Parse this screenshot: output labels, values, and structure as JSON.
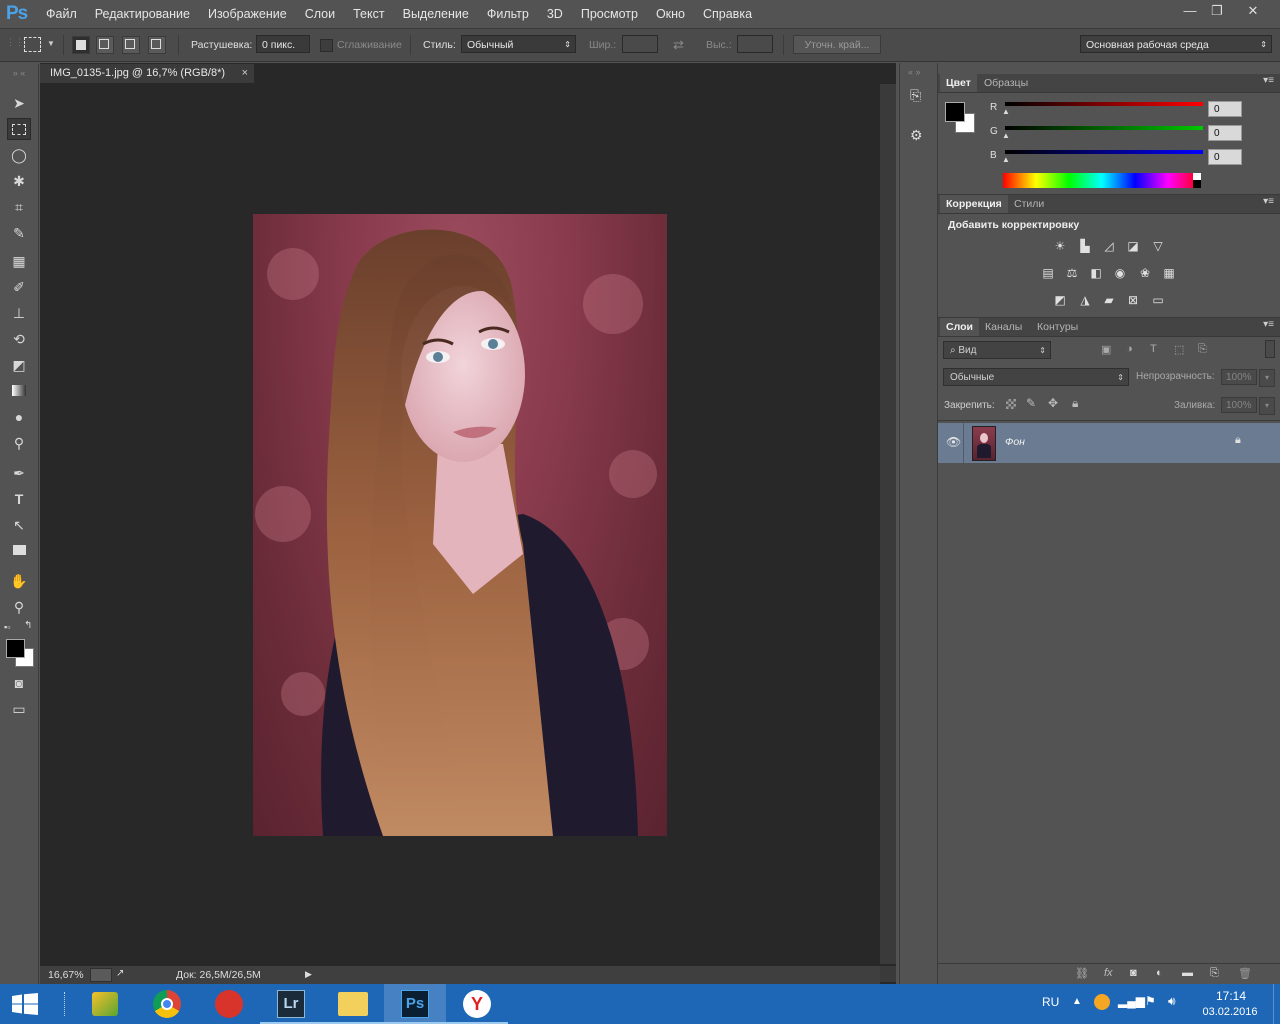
{
  "menu": {
    "items": [
      "Файл",
      "Редактирование",
      "Изображение",
      "Слои",
      "Текст",
      "Выделение",
      "Фильтр",
      "3D",
      "Просмотр",
      "Окно",
      "Справка"
    ]
  },
  "options": {
    "feather_label": "Растушевка:",
    "feather_value": "0 пикс.",
    "antialias_label": "Сглаживание",
    "style_label": "Стиль:",
    "style_value": "Обычный",
    "width_label": "Шир.:",
    "height_label": "Выс.:",
    "refine_label": "Уточн. край...",
    "workspace_value": "Основная рабочая среда"
  },
  "document": {
    "tab_title": "IMG_0135-1.jpg @ 16,7% (RGB/8*)",
    "zoom": "16,67%",
    "doc_size": "Док: 26,5M/26,5M"
  },
  "color_panel": {
    "tabs": [
      "Цвет",
      "Образцы"
    ],
    "channels": [
      {
        "label": "R",
        "value": "0",
        "color": "#ff0000"
      },
      {
        "label": "G",
        "value": "0",
        "color": "#00c800"
      },
      {
        "label": "B",
        "value": "0",
        "color": "#0000ff"
      }
    ]
  },
  "adjust_panel": {
    "tabs": [
      "Коррекция",
      "Стили"
    ],
    "title": "Добавить корректировку"
  },
  "layers_panel": {
    "tabs": [
      "Слои",
      "Каналы",
      "Контуры"
    ],
    "filter_value": "Вид",
    "blend_mode": "Обычные",
    "opacity_label": "Непрозрачность:",
    "opacity_value": "100%",
    "lock_label": "Закрепить:",
    "fill_label": "Заливка:",
    "fill_value": "100%",
    "layer_name": "Фон"
  },
  "taskbar": {
    "lang": "RU",
    "time": "17:14",
    "date": "03.02.2016",
    "apps": [
      "lightroom",
      "file-explorer",
      "photoshop",
      "yandex-browser"
    ],
    "lr_label": "Lr",
    "ps_label": "Ps"
  }
}
